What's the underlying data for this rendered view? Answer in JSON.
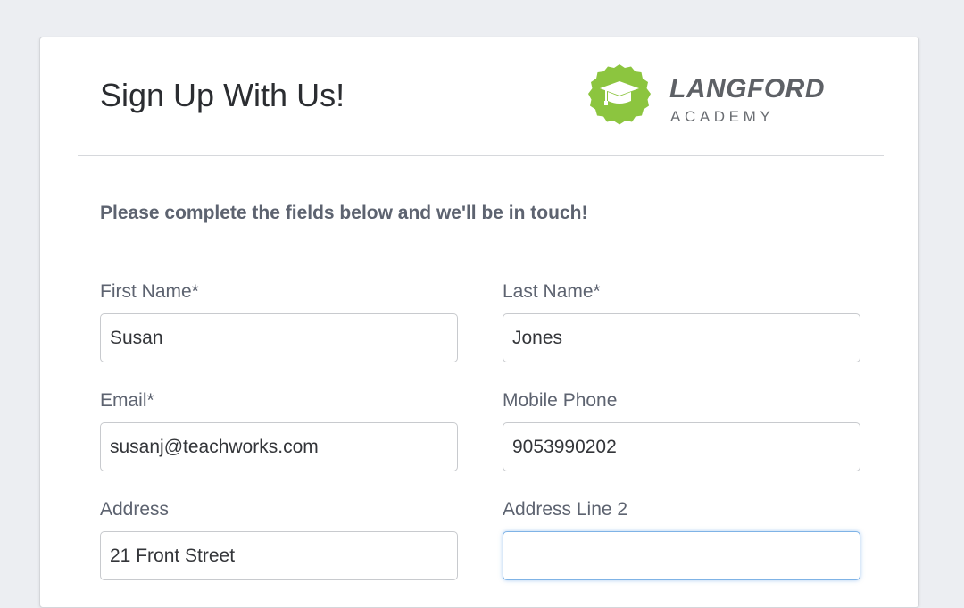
{
  "header": {
    "title": "Sign Up With Us!"
  },
  "logo": {
    "name": "LANGFORD",
    "subtitle": "ACADEMY",
    "badge_color": "#8cc53f",
    "icon": "graduation-cap-icon"
  },
  "form": {
    "intro": "Please complete the fields below and we'll be in touch!",
    "fields": {
      "first_name": {
        "label": "First Name*",
        "value": "Susan"
      },
      "last_name": {
        "label": "Last Name*",
        "value": "Jones"
      },
      "email": {
        "label": "Email*",
        "value": "susanj@teachworks.com"
      },
      "mobile_phone": {
        "label": "Mobile Phone",
        "value": "9053990202"
      },
      "address": {
        "label": "Address",
        "value": "21 Front Street"
      },
      "address_line_2": {
        "label": "Address Line 2",
        "value": ""
      }
    }
  },
  "colors": {
    "focus_border": "#7fb3e6",
    "label_text": "#5d6370"
  }
}
